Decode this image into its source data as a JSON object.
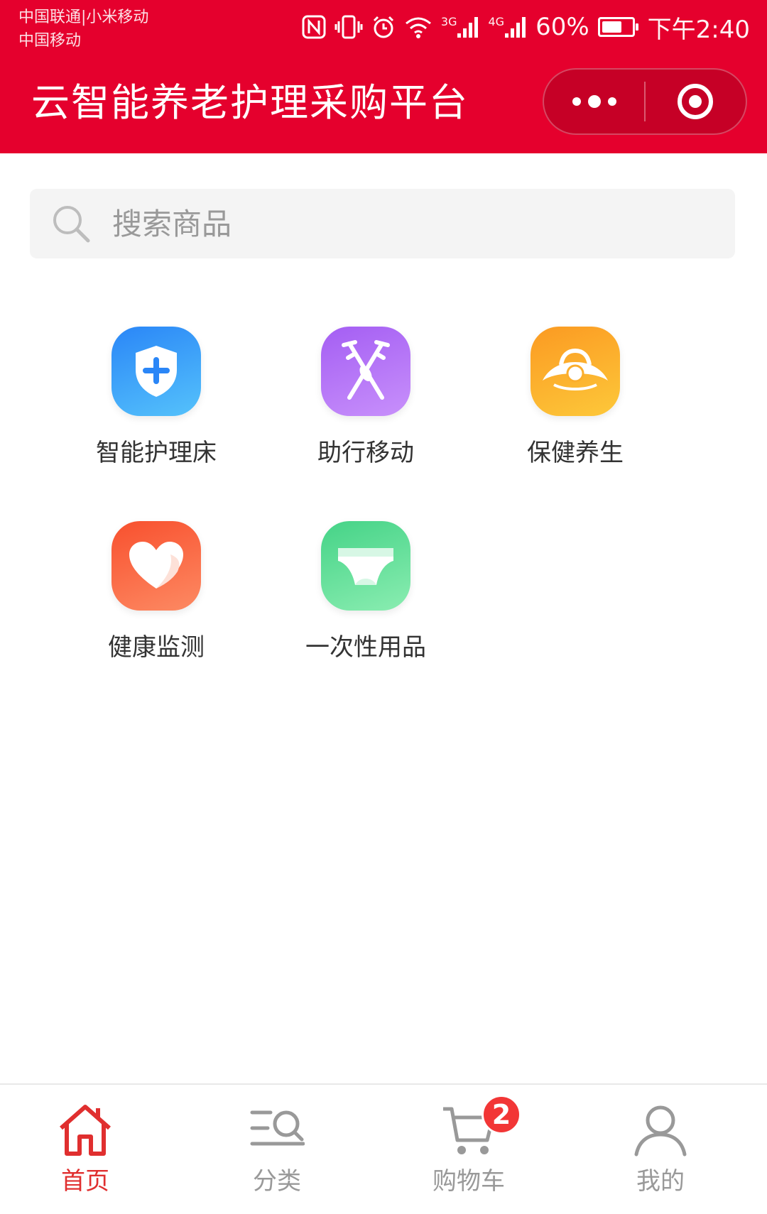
{
  "status_bar": {
    "carrier_line1": "中国联通|小米移动",
    "carrier_line2": "中国移动",
    "network_3g": "3G",
    "network_4g": "4G",
    "battery": "60%",
    "time": "下午2:40",
    "icons": [
      "nfc-icon",
      "vibrate-icon",
      "alarm-icon",
      "wifi-icon",
      "signal-icon",
      "battery-icon"
    ]
  },
  "header": {
    "title": "云智能养老护理采购平台",
    "background_color": "#e5002d"
  },
  "search": {
    "placeholder": "搜索商品"
  },
  "categories": [
    {
      "label": "智能护理床",
      "icon": "shield-plus-icon",
      "color": "#2a86f7"
    },
    {
      "label": "助行移动",
      "icon": "crutches-icon",
      "color": "#a45ef3"
    },
    {
      "label": "保健养生",
      "icon": "wellness-icon",
      "color": "#fb9a22"
    },
    {
      "label": "健康监测",
      "icon": "heart-icon",
      "color": "#f8502e"
    },
    {
      "label": "一次性用品",
      "icon": "diaper-icon",
      "color": "#45d387"
    }
  ],
  "tabbar": {
    "active_color": "#e02f2f",
    "inactive_color": "#999999",
    "items": [
      {
        "label": "首页",
        "icon": "home-icon",
        "active": true
      },
      {
        "label": "分类",
        "icon": "category-icon",
        "active": false
      },
      {
        "label": "购物车",
        "icon": "cart-icon",
        "active": false,
        "badge": "2"
      },
      {
        "label": "我的",
        "icon": "user-icon",
        "active": false
      }
    ]
  }
}
